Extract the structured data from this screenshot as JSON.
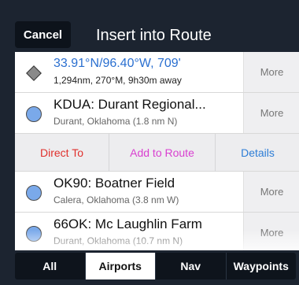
{
  "header": {
    "cancel_label": "Cancel",
    "title": "Insert into Route"
  },
  "rows": [
    {
      "icon": "waypoint-diamond-icon",
      "name": "33.91°N/96.40°W, 709'",
      "detail": "1,294nm, 270°M, 9h30m away",
      "more_label": "More"
    },
    {
      "icon": "airport-circle-icon",
      "name": "KDUA: Durant Regional...",
      "detail": "Durant, Oklahoma  (1.8 nm N)",
      "more_label": "More"
    },
    {
      "icon": "airport-circle-icon",
      "name": "OK90: Boatner Field",
      "detail": "Calera, Oklahoma  (3.8 nm W)",
      "more_label": "More"
    },
    {
      "icon": "airport-circle-icon",
      "name": "66OK: Mc Laughlin Farm",
      "detail": "Durant, Oklahoma  (10.7 nm N)",
      "more_label": "More"
    }
  ],
  "actions": {
    "direct_to": "Direct To",
    "add_to_route": "Add to Route",
    "details": "Details"
  },
  "tabs": [
    {
      "label": "All",
      "selected": false
    },
    {
      "label": "Airports",
      "selected": true
    },
    {
      "label": "Nav",
      "selected": false
    },
    {
      "label": "Waypoints",
      "selected": false
    }
  ],
  "colors": {
    "background": "#1c2430",
    "coordinate_text": "#2a6fd0",
    "direct_to": "#e0302c",
    "add_to_route": "#d940d0",
    "details": "#2d7dd6",
    "airport_icon": "#7aa9ea"
  }
}
